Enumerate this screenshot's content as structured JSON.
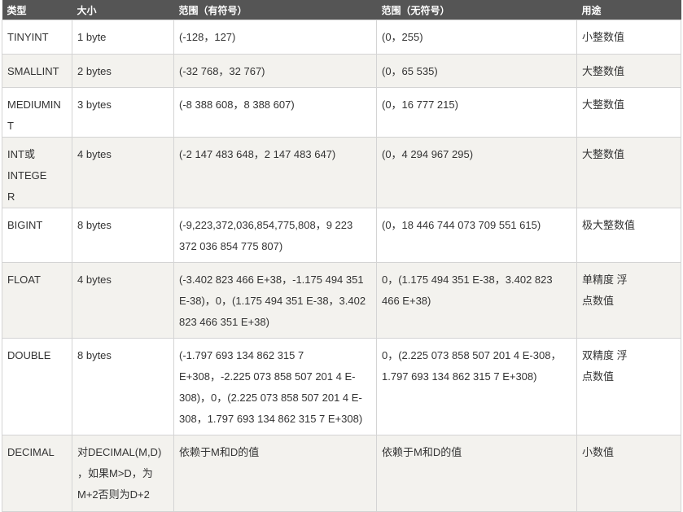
{
  "table": {
    "headers": [
      "类型",
      "大小",
      "范围（有符号）",
      "范围（无符号）",
      "用途"
    ],
    "rows": [
      {
        "type": "TINYINT",
        "size": "1 byte",
        "signed": "(-128，127)",
        "unsigned": "(0，255)",
        "usage": "小整数值"
      },
      {
        "type": "SMALLINT",
        "size": "2 bytes",
        "signed": "(-32 768，32 767)",
        "unsigned": "(0，65 535)",
        "usage": "大整数值"
      },
      {
        "type": "MEDIUMINT",
        "size": "3 bytes",
        "signed": "(-8 388 608，8 388 607)",
        "unsigned": "(0，16 777 215)",
        "usage": "大整数值"
      },
      {
        "type": "INT或INTEGER",
        "size": "4 bytes",
        "signed": "(-2 147 483 648，2 147 483 647)",
        "unsigned": "(0，4 294 967 295)",
        "usage": "大整数值"
      },
      {
        "type": "BIGINT",
        "size": "8 bytes",
        "signed": "(-9,223,372,036,854,775,808，9 223 372 036 854 775 807)",
        "unsigned": "(0，18 446 744 073 709 551 615)",
        "usage": "极大整数值"
      },
      {
        "type": "FLOAT",
        "size": "4 bytes",
        "signed": "(-3.402 823 466 E+38，-1.175 494 351 E-38)，0，(1.175 494 351 E-38，3.402 823 466 351 E+38)",
        "unsigned": "0，(1.175 494 351 E-38，3.402 823 466 E+38)",
        "usage": "单精度 浮点数值"
      },
      {
        "type": "DOUBLE",
        "size": "8 bytes",
        "signed": "(-1.797 693 134 862 315 7 E+308，-2.225 073 858 507 201 4 E-308)，0，(2.225 073 858 507 201 4 E-308，1.797 693 134 862 315 7 E+308)",
        "unsigned": "0，(2.225 073 858 507 201 4 E-308，1.797 693 134 862 315 7 E+308)",
        "usage": "双精度 浮点数值"
      },
      {
        "type": "DECIMAL",
        "size": "对DECIMAL(M,D) ，如果M>D，为M+2否则为D+2",
        "signed": "依赖于M和D的值",
        "unsigned": "依赖于M和D的值",
        "usage": "小数值"
      }
    ]
  }
}
